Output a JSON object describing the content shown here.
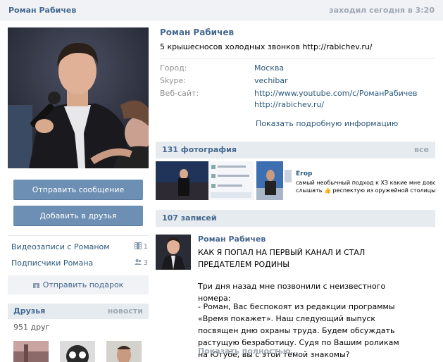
{
  "header": {
    "name": "Роман Рабичев",
    "last_seen": "заходил сегодня в 3:20"
  },
  "actions": {
    "send_message": "Отправить сообщение",
    "add_friend": "Добавить в друзья",
    "send_gift": "Отправить подарок"
  },
  "side_links": [
    {
      "label": "Видеозаписи с Романом",
      "count": "1"
    },
    {
      "label": "Подписчики Романа",
      "count": "3"
    }
  ],
  "friends": {
    "title": "Друзья",
    "news_link": "новости",
    "count_text": "951 друг"
  },
  "profile": {
    "name": "Роман Рабичев",
    "status": "5 крышесносов холодных звонков http://rabichev.ru/",
    "fields": [
      {
        "label": "Город:",
        "values": [
          "Москва"
        ]
      },
      {
        "label": "Skype:",
        "values": [
          "vechibar"
        ]
      },
      {
        "label": "Веб-сайт:",
        "values": [
          "http://www.youtube.com/c/РоманРабичев",
          "http://rabichev.ru/"
        ]
      }
    ],
    "more_info": "Показать подробную информацию"
  },
  "photos": {
    "title": "131 фотография",
    "all_link": "все",
    "chat_name": "Егор",
    "chat_text_1": "самый необычный подход к ХЗ какие мне доводилось ви",
    "chat_text_2": "слышать 👍 респектую из оружейной столицы России 👍"
  },
  "wall": {
    "title": "107 записей",
    "post": {
      "author": "Роман Рабичев",
      "headline": "КАК Я ПОПАЛ НА ПЕРВЫЙ КАНАЛ И СТАЛ ПРЕДАТЕЛЕМ РОДИНЫ",
      "para1": "Три дня назад мне позвонили с неизвестного номера:",
      "para2": "- Роман, Вас беспокоят из редакции программы «Время покажет». Наш следующий выпуск посвящен дню охраны труда. Будем обсуждать растущую безработицу. Судя по Вашим роликам на Ютубе, вы с этой темой знакомы?",
      "show_more": "Показать полностью…"
    }
  },
  "colors": {
    "link": "#2b587a",
    "header_blue": "#45688e",
    "button": "#6d8fb3",
    "muted": "#a0a9b5"
  }
}
